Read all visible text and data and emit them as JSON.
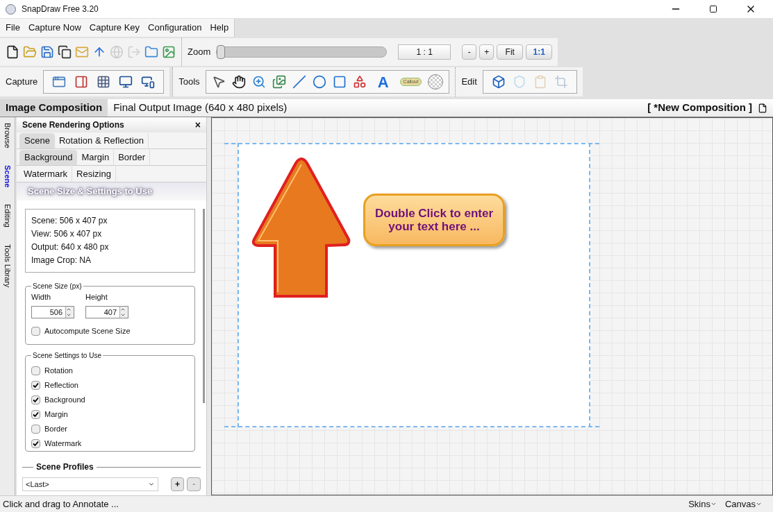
{
  "window": {
    "title": "SnapDraw Free 3.20"
  },
  "menu": [
    "File",
    "Capture Now",
    "Capture Key",
    "Configuration",
    "Help"
  ],
  "file_tools": [
    {
      "kind": "new",
      "disabled": false
    },
    {
      "kind": "open",
      "disabled": false
    },
    {
      "kind": "save",
      "disabled": false
    },
    {
      "kind": "copy",
      "disabled": false
    },
    {
      "kind": "mail",
      "disabled": false
    },
    {
      "kind": "upload",
      "disabled": false
    },
    {
      "kind": "web",
      "disabled": true
    },
    {
      "kind": "export",
      "disabled": true
    },
    {
      "kind": "folder",
      "disabled": false
    },
    {
      "kind": "image",
      "disabled": false
    }
  ],
  "zoom": {
    "label": "Zoom",
    "level": 0,
    "value": "1 : 1",
    "buttons": [
      {
        "label": "-",
        "selected": false
      },
      {
        "label": "+",
        "selected": false
      },
      {
        "label": "Fit",
        "selected": false
      },
      {
        "label": "1:1",
        "selected": true
      }
    ]
  },
  "capture": {
    "label": "Capture",
    "tools": [
      {
        "kind": "window",
        "disabled": false
      },
      {
        "kind": "region",
        "disabled": false
      },
      {
        "kind": "checker",
        "disabled": false
      },
      {
        "kind": "monitor",
        "disabled": false
      },
      {
        "kind": "monitors",
        "disabled": false
      }
    ]
  },
  "tools": {
    "label": "Tools",
    "tools": [
      {
        "kind": "pointer",
        "disabled": false
      },
      {
        "kind": "hand",
        "disabled": false
      },
      {
        "kind": "zoom",
        "disabled": false
      },
      {
        "kind": "pictures",
        "disabled": false
      },
      {
        "kind": "line",
        "disabled": false
      },
      {
        "kind": "ellipse",
        "disabled": false
      },
      {
        "kind": "rect",
        "disabled": false
      },
      {
        "kind": "shapes",
        "disabled": false
      },
      {
        "kind": "text",
        "label": "A",
        "disabled": false
      },
      {
        "kind": "callout",
        "label": "Callout",
        "disabled": false
      },
      {
        "kind": "transparent",
        "disabled": false
      }
    ]
  },
  "edit": {
    "label": "Edit",
    "tools": [
      {
        "kind": "cube",
        "disabled": false
      },
      {
        "kind": "shield",
        "disabled": true
      },
      {
        "kind": "paste",
        "disabled": true
      },
      {
        "kind": "crop",
        "disabled": true
      }
    ]
  },
  "doc_tabs": [
    {
      "label": "Image Composition",
      "selected": true
    },
    {
      "label": "Final Output Image (640 x 480 pixels)",
      "selected": false
    }
  ],
  "composition_name": "[ *New Composition ]",
  "side_tabs": [
    {
      "label": "Browse",
      "selected": false
    },
    {
      "label": "Scene",
      "selected": true
    },
    {
      "label": "Editing",
      "selected": false
    },
    {
      "label": "Tools Library",
      "selected": false
    }
  ],
  "panel": {
    "title": "Scene Rendering Options",
    "close": "×",
    "tab_rows": [
      [
        {
          "label": "Scene",
          "selected": true
        },
        {
          "label": "Rotation & Reflection",
          "selected": false
        }
      ],
      [
        {
          "label": "Background",
          "selected": true
        },
        {
          "label": "Margin",
          "selected": false
        },
        {
          "label": "Border",
          "selected": false
        }
      ],
      [
        {
          "label": "Watermark",
          "selected": false
        },
        {
          "label": "Resizing",
          "selected": false
        }
      ]
    ],
    "section_title": "Scene Size & Settings to Use",
    "info": [
      "Scene: 506 x 407 px",
      "View: 506 x 407 px",
      "Output: 640 x 480 px",
      "Image Crop: NA"
    ],
    "scene_size": {
      "legend": "Scene Size (px)",
      "fields": [
        {
          "label": "Width",
          "value": "506"
        },
        {
          "label": "Height",
          "value": "407"
        }
      ],
      "autocompute": {
        "label": "Autocompute Scene Size",
        "checked": false
      }
    },
    "settings": {
      "legend": "Scene Settings to Use",
      "items": [
        {
          "label": "Rotation",
          "checked": false
        },
        {
          "label": "Reflection",
          "checked": true
        },
        {
          "label": "Background",
          "checked": true
        },
        {
          "label": "Margin",
          "checked": true
        },
        {
          "label": "Border",
          "checked": false
        },
        {
          "label": "Watermark",
          "checked": true
        }
      ]
    },
    "profiles": {
      "title": "Scene Profiles",
      "value": "<Last>",
      "buttons": [
        "+",
        "-"
      ]
    }
  },
  "canvas": {
    "callout": "Double Click to enter your text here ..."
  },
  "status_bar": {
    "text": "Click and drag to Annotate ...",
    "menus": [
      "Skins",
      "Canvas"
    ]
  }
}
